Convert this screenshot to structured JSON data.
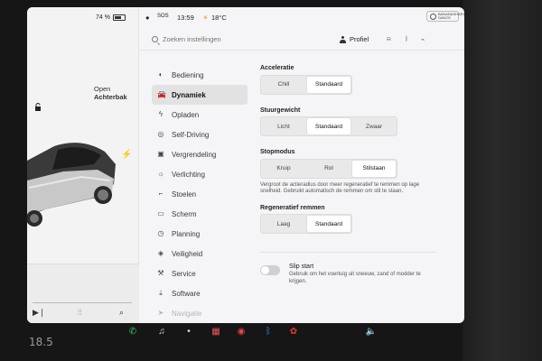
{
  "status": {
    "battery_percent": "74 %",
    "battery_fraction": 0.74,
    "sos_label": "SOS",
    "time": "13:59",
    "outside_temp": "18°C",
    "badge_text": "BANANASHARING DANCE"
  },
  "car": {
    "trunk_line1": "Open",
    "trunk_line2": "Achterbak"
  },
  "search": {
    "placeholder": "Zoeken instellingen"
  },
  "profile": {
    "label": "Profiel"
  },
  "menu": {
    "items": [
      {
        "label": "Bediening",
        "icon": "toggle-icon"
      },
      {
        "label": "Dynamiek",
        "icon": "car-icon"
      },
      {
        "label": "Opladen",
        "icon": "bolt-icon"
      },
      {
        "label": "Self-Driving",
        "icon": "steering-wheel-icon"
      },
      {
        "label": "Vergrendeling",
        "icon": "lock-icon"
      },
      {
        "label": "Verlichting",
        "icon": "light-icon"
      },
      {
        "label": "Stoelen",
        "icon": "seat-icon"
      },
      {
        "label": "Scherm",
        "icon": "screen-icon"
      },
      {
        "label": "Planning",
        "icon": "clock-icon"
      },
      {
        "label": "Veiligheid",
        "icon": "shield-icon"
      },
      {
        "label": "Service",
        "icon": "wrench-icon"
      },
      {
        "label": "Software",
        "icon": "download-icon"
      },
      {
        "label": "Navigatie",
        "icon": "navigation-icon"
      }
    ],
    "active_index": 1
  },
  "settings": {
    "acceleration": {
      "label": "Acceleratie",
      "options": [
        "Chill",
        "Standaard"
      ],
      "selected": "Standaard"
    },
    "steering": {
      "label": "Stuurgewicht",
      "options": [
        "Licht",
        "Standaard",
        "Zwaar"
      ],
      "selected": "Standaard"
    },
    "stop_mode": {
      "label": "Stopmodus",
      "options": [
        "Kruip",
        "Rol",
        "Stilstaan"
      ],
      "selected": "Stilstaan",
      "help": "Vergroot de actieradius door meer regeneratief te remmen op lage snelheid. Gebruikt automatisch de remmen om stil te staan."
    },
    "regen": {
      "label": "Regeneratief remmen",
      "options": [
        "Laag",
        "Standaard"
      ],
      "selected": "Standaard"
    },
    "slip_start": {
      "label": "Slip start",
      "help": "Gebruik om het voertuig uit sneeuw, zand of modder te krijgen.",
      "enabled": false
    }
  },
  "taskbar": {
    "temperature": "18.5"
  },
  "colors": {
    "screen_bg": "#f5f5f7",
    "selected_segment": "#ffffff",
    "segment_bg": "#e9e9e9",
    "active_menu_bg": "#e2e2e2"
  }
}
